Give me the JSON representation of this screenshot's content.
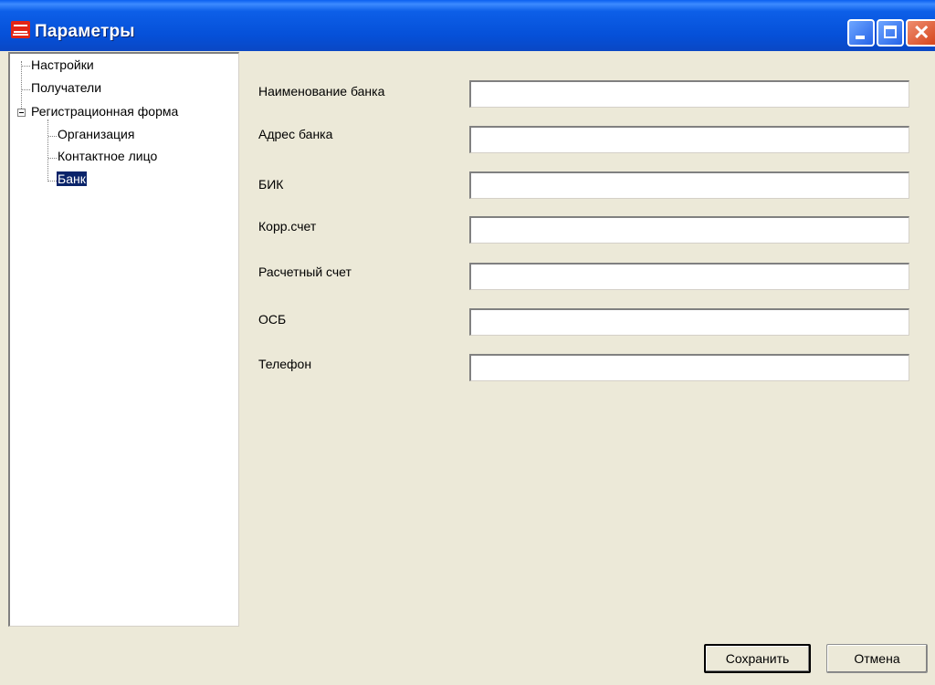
{
  "window": {
    "title": "Параметры",
    "icons": {
      "app": "app-icon",
      "minimize": "minimize-icon",
      "maximize": "maximize-icon",
      "close": "close-icon"
    },
    "close_glyph": "✕"
  },
  "tree": {
    "items": [
      {
        "label": "Настройки"
      },
      {
        "label": "Получатели"
      },
      {
        "label": "Регистрационная форма",
        "expanded": true
      },
      {
        "label": "Организация"
      },
      {
        "label": "Контактное лицо"
      },
      {
        "label": "Банк",
        "selected": true
      }
    ]
  },
  "form": {
    "fields": [
      {
        "label": "Наименование банка",
        "value": ""
      },
      {
        "label": "Адрес банка",
        "value": ""
      },
      {
        "label": "БИК",
        "value": ""
      },
      {
        "label": "Корр.счет",
        "value": ""
      },
      {
        "label": "Расчетный счет",
        "value": ""
      },
      {
        "label": "ОСБ",
        "value": ""
      },
      {
        "label": "Телефон",
        "value": ""
      }
    ]
  },
  "buttons": {
    "save": "Сохранить",
    "cancel": "Отмена"
  },
  "colors": {
    "titlebar": "#0550d8",
    "selection": "#0a246a",
    "face": "#ece9d8"
  }
}
